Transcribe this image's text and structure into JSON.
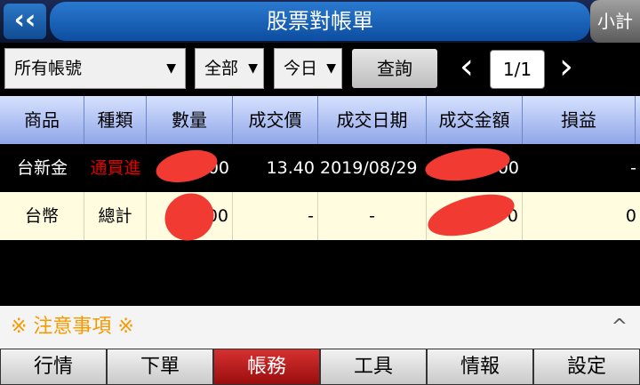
{
  "header": {
    "back_icon": "‹‹",
    "title": "股票對帳單",
    "calc_label": "小計"
  },
  "toolbar": {
    "account": "所有帳號",
    "category": "全部",
    "date": "今日",
    "query_label": "查詢",
    "page": "1/1",
    "prev_icon": "‹",
    "next_icon": "›",
    "dropdown_arrow": "▼"
  },
  "table": {
    "headers": [
      "商品",
      "種類",
      "數量",
      "成交價",
      "成交日期",
      "成交金額",
      "損益"
    ],
    "rows": [
      {
        "product": "台新金",
        "type": "通買進",
        "quantity": "00",
        "price": "13.40",
        "date": "2019/08/29",
        "amount": "00",
        "pnl": "-"
      },
      {
        "product": "台幣",
        "type": "總計",
        "quantity": "00",
        "price": "-",
        "date": "-",
        "amount": "0",
        "pnl": "0"
      }
    ]
  },
  "notice": {
    "title": "※ 注意事項 ※",
    "toggle_icon": "^"
  },
  "bottom_nav": {
    "tabs": [
      "行情",
      "下單",
      "帳務",
      "工具",
      "情報",
      "設定"
    ],
    "active": "帳務"
  },
  "colors": {
    "accent_red": "#e00000",
    "header_blue": "#1f6fc8",
    "notice_orange": "#f39a00"
  }
}
